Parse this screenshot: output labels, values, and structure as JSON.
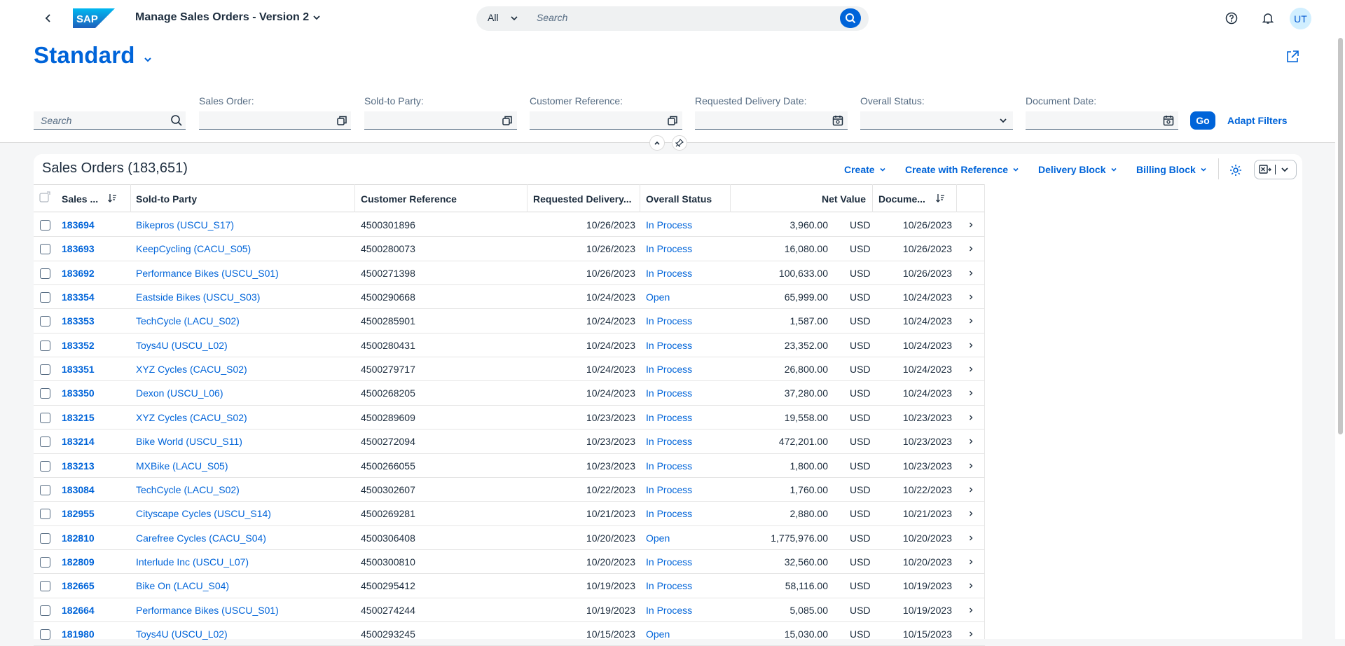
{
  "shell": {
    "app_title": "Manage Sales Orders - Version 2",
    "search_scope": "All",
    "search_placeholder": "Search",
    "avatar_initials": "UT",
    "logo_text": "SAP"
  },
  "header": {
    "variant": "Standard"
  },
  "filters": {
    "search_placeholder": "Search",
    "fields": [
      {
        "label": "Sales Order:"
      },
      {
        "label": "Sold-to Party:"
      },
      {
        "label": "Customer Reference:"
      },
      {
        "label": "Requested Delivery Date:"
      },
      {
        "label": "Overall Status:"
      },
      {
        "label": "Document Date:"
      }
    ],
    "go_label": "Go",
    "adapt_label": "Adapt Filters"
  },
  "table": {
    "title": "Sales Orders (183,651)",
    "toolbar": [
      "Create",
      "Create with Reference",
      "Delivery Block",
      "Billing Block"
    ],
    "columns": [
      "Sales ...",
      "Sold-to Party",
      "Customer Reference",
      "Requested Delivery...",
      "Overall Status",
      "Net Value",
      "Docume..."
    ],
    "rows": [
      [
        "183694",
        "Bikepros (USCU_S17)",
        "4500301896",
        "10/26/2023",
        "In Process",
        "3,960.00",
        "USD",
        "10/26/2023"
      ],
      [
        "183693",
        "KeepCycling (CACU_S05)",
        "4500280073",
        "10/26/2023",
        "In Process",
        "16,080.00",
        "USD",
        "10/26/2023"
      ],
      [
        "183692",
        "Performance Bikes (USCU_S01)",
        "4500271398",
        "10/26/2023",
        "In Process",
        "100,633.00",
        "USD",
        "10/26/2023"
      ],
      [
        "183354",
        "Eastside Bikes (USCU_S03)",
        "4500290668",
        "10/24/2023",
        "Open",
        "65,999.00",
        "USD",
        "10/24/2023"
      ],
      [
        "183353",
        "TechCycle (LACU_S02)",
        "4500285901",
        "10/24/2023",
        "In Process",
        "1,587.00",
        "USD",
        "10/24/2023"
      ],
      [
        "183352",
        "Toys4U (USCU_L02)",
        "4500280431",
        "10/24/2023",
        "In Process",
        "23,352.00",
        "USD",
        "10/24/2023"
      ],
      [
        "183351",
        "XYZ Cycles (CACU_S02)",
        "4500279717",
        "10/24/2023",
        "In Process",
        "26,800.00",
        "USD",
        "10/24/2023"
      ],
      [
        "183350",
        "Dexon (USCU_L06)",
        "4500268205",
        "10/24/2023",
        "In Process",
        "37,280.00",
        "USD",
        "10/24/2023"
      ],
      [
        "183215",
        "XYZ Cycles (CACU_S02)",
        "4500289609",
        "10/23/2023",
        "In Process",
        "19,558.00",
        "USD",
        "10/23/2023"
      ],
      [
        "183214",
        "Bike World (USCU_S11)",
        "4500272094",
        "10/23/2023",
        "In Process",
        "472,201.00",
        "USD",
        "10/23/2023"
      ],
      [
        "183213",
        "MXBike (LACU_S05)",
        "4500266055",
        "10/23/2023",
        "In Process",
        "1,800.00",
        "USD",
        "10/23/2023"
      ],
      [
        "183084",
        "TechCycle (LACU_S02)",
        "4500302607",
        "10/22/2023",
        "In Process",
        "1,760.00",
        "USD",
        "10/22/2023"
      ],
      [
        "182955",
        "Cityscape Cycles (USCU_S14)",
        "4500269281",
        "10/21/2023",
        "In Process",
        "2,880.00",
        "USD",
        "10/21/2023"
      ],
      [
        "182810",
        "Carefree Cycles (CACU_S04)",
        "4500306408",
        "10/20/2023",
        "Open",
        "1,775,976.00",
        "USD",
        "10/20/2023"
      ],
      [
        "182809",
        "Interlude Inc (USCU_L07)",
        "4500300810",
        "10/20/2023",
        "In Process",
        "32,560.00",
        "USD",
        "10/20/2023"
      ],
      [
        "182665",
        "Bike On (LACU_S04)",
        "4500295412",
        "10/19/2023",
        "In Process",
        "58,116.00",
        "USD",
        "10/19/2023"
      ],
      [
        "182664",
        "Performance Bikes (USCU_S01)",
        "4500274244",
        "10/19/2023",
        "In Process",
        "5,085.00",
        "USD",
        "10/19/2023"
      ],
      [
        "181980",
        "Toys4U (USCU_L02)",
        "4500293245",
        "10/15/2023",
        "Open",
        "15,030.00",
        "USD",
        "10/15/2023"
      ]
    ]
  },
  "colors": {
    "accent": "#0064d9",
    "text": "#1d2d3e",
    "label": "#556b82"
  }
}
